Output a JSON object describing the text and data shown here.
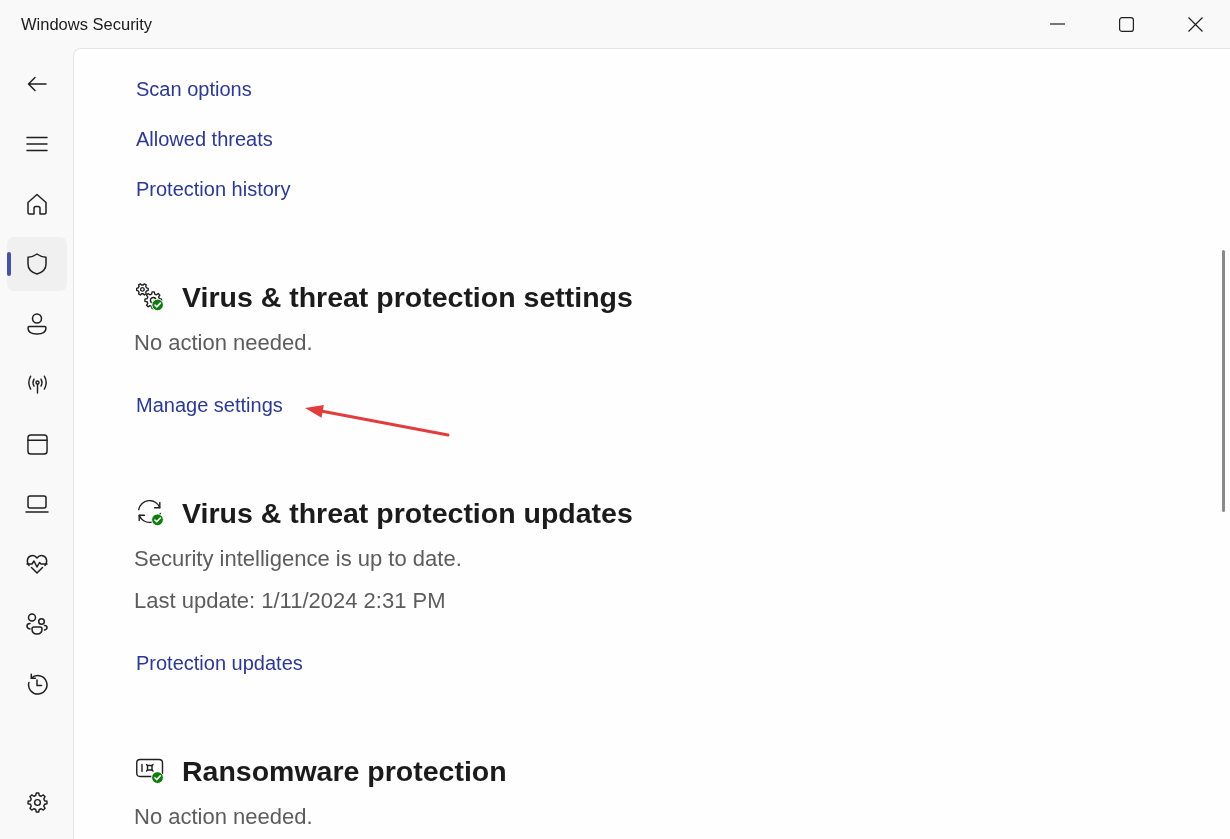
{
  "window": {
    "title": "Windows Security"
  },
  "sidebar": {
    "items": [
      {
        "kind": "home",
        "selected": false
      },
      {
        "kind": "shield",
        "selected": true
      },
      {
        "kind": "account",
        "selected": false
      },
      {
        "kind": "network",
        "selected": false
      },
      {
        "kind": "app",
        "selected": false
      },
      {
        "kind": "device",
        "selected": false
      },
      {
        "kind": "health",
        "selected": false
      },
      {
        "kind": "family",
        "selected": false
      },
      {
        "kind": "history",
        "selected": false
      }
    ],
    "settings_item": {
      "selected": false
    }
  },
  "links": [
    "Scan options",
    "Allowed threats",
    "Protection history"
  ],
  "sections": [
    {
      "kind": "settings",
      "protected": true,
      "heading": "Virus & threat protection settings",
      "lines": [
        "No action needed."
      ],
      "link": {
        "label": "Manage settings",
        "annotated": true
      }
    },
    {
      "kind": "updates",
      "protected": true,
      "heading": "Virus & threat protection updates",
      "lines": [
        "Security intelligence is up to date.",
        "Last update: 1/11/2024 2:31 PM"
      ],
      "link": {
        "label": "Protection updates",
        "annotated": false
      }
    },
    {
      "kind": "ransomware",
      "protected": true,
      "heading": "Ransomware protection",
      "lines": [
        "No action needed."
      ]
    }
  ]
}
